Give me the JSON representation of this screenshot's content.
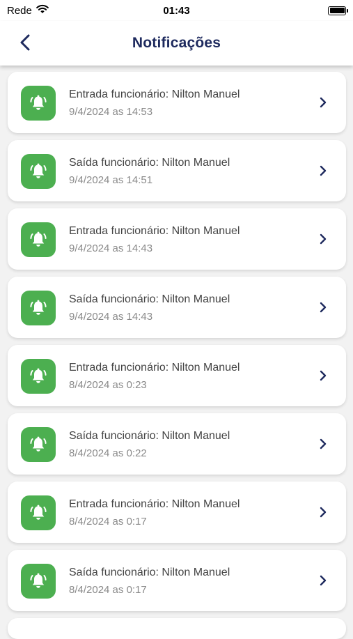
{
  "status_bar": {
    "carrier": "Rede",
    "time": "01:43"
  },
  "header": {
    "title": "Notificações"
  },
  "notifications": [
    {
      "title": "Entrada funcionário: Nilton Manuel",
      "date": "9/4/2024 as 14:53"
    },
    {
      "title": "Saída funcionário: Nilton Manuel",
      "date": "9/4/2024 as 14:51"
    },
    {
      "title": "Entrada funcionário: Nilton Manuel",
      "date": "9/4/2024 as 14:43"
    },
    {
      "title": "Saída funcionário: Nilton Manuel",
      "date": "9/4/2024 as 14:43"
    },
    {
      "title": "Entrada funcionário: Nilton Manuel",
      "date": "8/4/2024 as 0:23"
    },
    {
      "title": "Saída funcionário: Nilton Manuel",
      "date": "8/4/2024 as 0:22"
    },
    {
      "title": "Entrada funcionário: Nilton Manuel",
      "date": "8/4/2024 as 0:17"
    },
    {
      "title": "Saída funcionário: Nilton Manuel",
      "date": "8/4/2024 as 0:17"
    }
  ],
  "colors": {
    "accent": "#4caf50",
    "title": "#1e2a5e",
    "chevron": "#1e2a5e"
  },
  "icons": {
    "back": "chevron-left-icon",
    "notification": "bell-ringing-icon",
    "row_action": "chevron-right-icon"
  }
}
